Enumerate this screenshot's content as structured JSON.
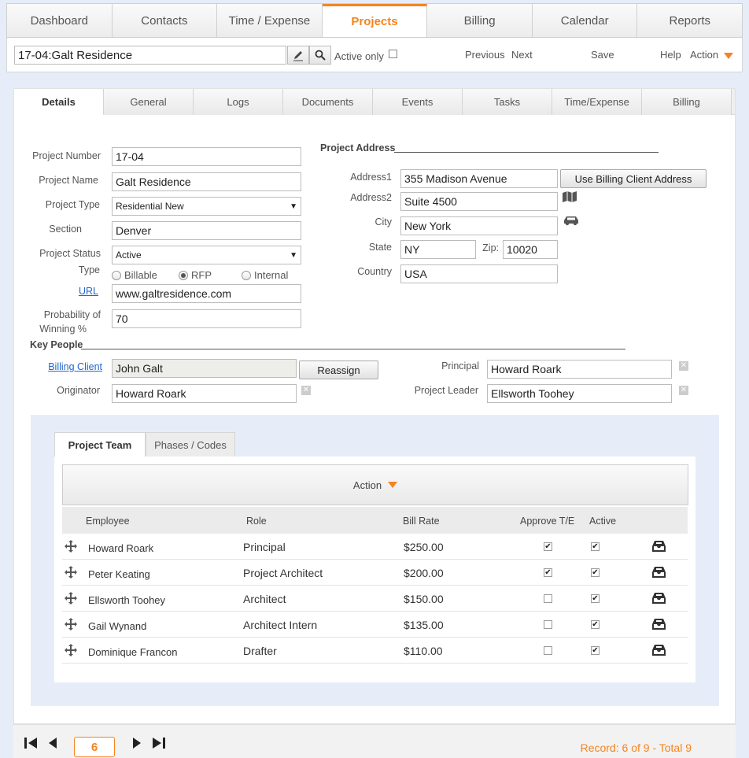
{
  "top_nav": {
    "tabs": [
      "Dashboard",
      "Contacts",
      "Time / Expense",
      "Projects",
      "Billing",
      "Calendar",
      "Reports"
    ],
    "active": "Projects"
  },
  "toolbar": {
    "search_value": "17-04:Galt Residence",
    "active_only_label": "Active only",
    "previous": "Previous",
    "next": "Next",
    "save": "Save",
    "help": "Help",
    "action": "Action"
  },
  "sub_tabs": [
    "Details",
    "General",
    "Logs",
    "Documents",
    "Events",
    "Tasks",
    "Time/Expense",
    "Billing"
  ],
  "details": {
    "project_number_label": "Project Number",
    "project_number": "17-04",
    "project_name_label": "Project Name",
    "project_name": "Galt Residence",
    "project_type_label": "Project Type",
    "project_type": "Residential New",
    "section_label": "Section",
    "section": "Denver",
    "project_status_label": "Project Status",
    "project_status": "Active",
    "type_label": "Type",
    "type_options": [
      "Billable",
      "RFP",
      "Internal"
    ],
    "type_selected": "RFP",
    "url_label": "URL",
    "url": "www.galtresidence.com",
    "probability_label_1": "Probability of",
    "probability_label_2": "Winning %",
    "probability": "70"
  },
  "address": {
    "header": "Project Address",
    "address1_label": "Address1",
    "address1": "355 Madison Avenue",
    "use_billing_button": "Use Billing Client Address",
    "address2_label": "Address2",
    "address2": "Suite 4500",
    "city_label": "City",
    "city": "New York",
    "state_label": "State",
    "state": "NY",
    "zip_label": "Zip:",
    "zip": "10020",
    "country_label": "Country",
    "country": "USA"
  },
  "key_people": {
    "header": "Key People",
    "billing_client_label": "Billing Client",
    "billing_client": "John Galt",
    "reassign_button": "Reassign",
    "originator_label": "Originator",
    "originator": "Howard Roark",
    "principal_label": "Principal",
    "principal": "Howard Roark",
    "project_leader_label": "Project Leader",
    "project_leader": "Ellsworth Toohey"
  },
  "team": {
    "tabs": [
      "Project Team",
      "Phases / Codes"
    ],
    "action_label": "Action",
    "columns": [
      "Employee",
      "Role",
      "Bill Rate",
      "Approve T/E",
      "Active"
    ],
    "rows": [
      {
        "employee": "Howard Roark",
        "role": "Principal",
        "rate": "$250.00",
        "approve": true,
        "active": true
      },
      {
        "employee": "Peter Keating",
        "role": "Project Architect",
        "rate": "$200.00",
        "approve": true,
        "active": true
      },
      {
        "employee": "Ellsworth Toohey",
        "role": "Architect",
        "rate": "$150.00",
        "approve": false,
        "active": true
      },
      {
        "employee": "Gail Wynand",
        "role": "Architect Intern",
        "rate": "$135.00",
        "approve": false,
        "active": true
      },
      {
        "employee": "Dominique Francon",
        "role": "Drafter",
        "rate": "$110.00",
        "approve": false,
        "active": true
      }
    ]
  },
  "footer": {
    "page": "6",
    "record_info": "Record: 6 of 9 - Total 9"
  },
  "colors": {
    "accent": "#f5841f",
    "link": "#2266cc"
  }
}
